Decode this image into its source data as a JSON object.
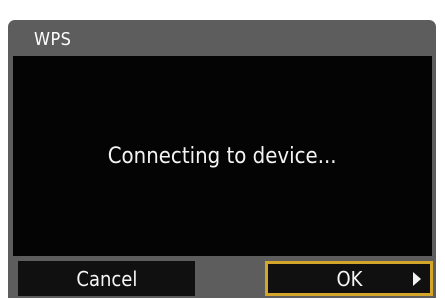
{
  "dialog": {
    "title": "WPS",
    "message": "Connecting to device...",
    "buttons": {
      "cancel_label": "Cancel",
      "ok_label": "OK"
    },
    "icons": {
      "ok_arrow": "right-triangle-icon"
    },
    "colors": {
      "background": "#5d5d5d",
      "panel": "#040404",
      "button": "#101010",
      "selection": "#d3a62b",
      "text": "#ffffff"
    }
  }
}
